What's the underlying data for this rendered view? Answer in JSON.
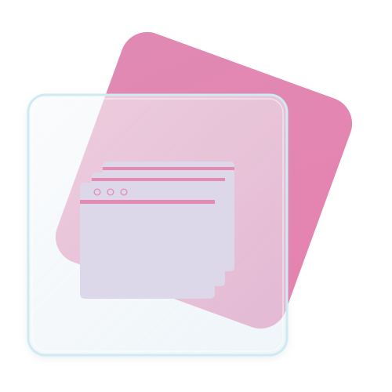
{
  "icon": {
    "name": "multiple-windows-icon",
    "window_count": 3
  },
  "colors": {
    "background": "#ffffff",
    "pink_card": "#e486b0",
    "glass_card_fill": "#f3f9fd",
    "glass_card_border": "#cfeaf2",
    "window_fill": "#dcd8ea",
    "window_dot": "#dcd8ea",
    "title_bar_band": "#e58ab3"
  }
}
